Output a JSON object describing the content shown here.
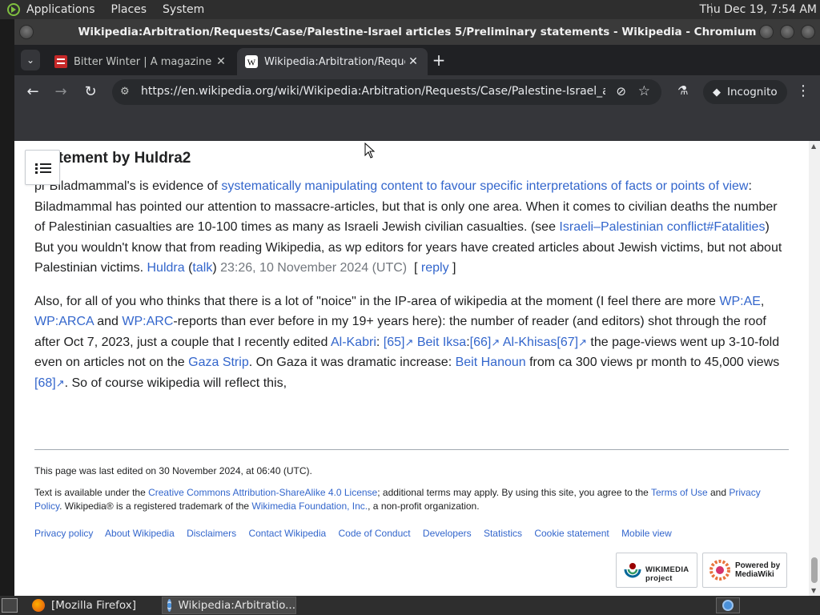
{
  "top_panel": {
    "menu": [
      "Applications",
      "Places",
      "System"
    ],
    "clock": "Thu Dec 19,  7:54 AM"
  },
  "window": {
    "title": "Wikipedia:Arbitration/Requests/Case/Palestine-Israel articles 5/Preliminary statements - Wikipedia - Chromium"
  },
  "tabs": [
    {
      "title": "Bitter Winter | A magazine on",
      "close": "✕",
      "favicon": "bitter-winter-favicon",
      "active": false
    },
    {
      "title": "Wikipedia:Arbitration/Requests",
      "close": "✕",
      "favicon": "wikipedia-favicon",
      "active": true
    }
  ],
  "toolbar": {
    "url": "https://en.wikipedia.org/wiki/Wikipedia:Arbitration/Requests/Case/Palestine-Israel_articles...",
    "incognito_label": "Incognito",
    "new_tab": "+"
  },
  "article": {
    "heading": "Statement by Huldra2",
    "p1": {
      "t1": "pr Biladmammal's is evidence of ",
      "link1": "systematically manipulating content to favour specific interpretations of facts or points of view",
      "t2": ": Biladmammal has pointed our attention to massacre-articles, but that is only one area. When it comes to civilian deaths the number of Palestinian casualties are 10-100 times as many as Israeli Jewish civilian casualties. (see ",
      "link2": "Israeli–Palestinian conflict#Fatalities",
      "t3": ") But you wouldn't know that from reading Wikipedia, as wp editors for years have created articles about Jewish victims, but not about Palestinian victims. ",
      "user": "Huldra",
      "talk": "talk",
      "timestamp": "23:26, 10 November 2024 (UTC)",
      "reply": "reply"
    },
    "p2": {
      "t1": "Also, for all of you who thinks that there is a lot of \"noice\" in the IP-area of wikipedia at the moment (I feel there are more ",
      "wp_ae": "WP:AE",
      "t2": ", ",
      "wp_arca": "WP:ARCA",
      "t3": " and ",
      "wp_arc": "WP:ARC",
      "t4": "-reports than ever before in my 19+ years here): the number of reader (and editors) shot through the roof after Oct 7, 2023, just a couple that I recently edited ",
      "al_kabri": "Al-Kabri",
      "ref65": "[65]",
      "beit_iksa": "Beit Iksa",
      "ref66": "[66]",
      "al_khisas": "Al-Khisas",
      "ref67": "[67]",
      "t5": " the page-views went up 3-10-fold even on articles not on the ",
      "gaza_strip": "Gaza Strip",
      "t6": ". On Gaza it was dramatic increase: ",
      "beit_hanoun": "Beit Hanoun",
      "t7": " from ca 300 views pr month to 45,000 views ",
      "ref68": "[68]",
      "t8": ". So of course wikipedia will reflect this,"
    }
  },
  "footer": {
    "last_edited": "This page was last edited on 30 November 2024, at 06:40 (UTC).",
    "license_t1": "Text is available under the ",
    "license_link": "Creative Commons Attribution-ShareAlike 4.0 License",
    "license_t2": "; additional terms may apply. By using this site, you agree to the ",
    "terms": "Terms of Use",
    "and": " and ",
    "privacy": "Privacy Policy",
    "license_t3": ". Wikipedia® is a registered trademark of the ",
    "wmf": "Wikimedia Foundation, Inc.",
    "license_t4": ", a non-profit organization.",
    "links": [
      "Privacy policy",
      "About Wikipedia",
      "Disclaimers",
      "Contact Wikipedia",
      "Code of Conduct",
      "Developers",
      "Statistics",
      "Cookie statement",
      "Mobile view"
    ],
    "wikimedia_badge": "WIKIMEDIA project",
    "mediawiki_badge": "Powered by MediaWiki"
  },
  "taskbar": {
    "tasks": [
      "[Mozilla Firefox]",
      "Wikipedia:Arbitratio..."
    ]
  }
}
